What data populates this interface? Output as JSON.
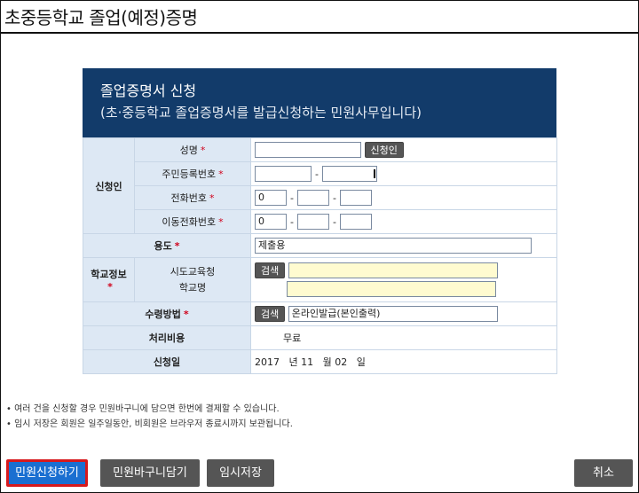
{
  "window": {
    "title": "초중등학교 졸업(예정)증명"
  },
  "form": {
    "header_title": "졸업증명서 신청",
    "header_subtitle": "(초·중등학교 졸업증명서를 발급신청하는 민원사무입니다)",
    "required_mark": "*",
    "applicant_group": "신청인",
    "name_label": "성명",
    "name_check_button": "신청인",
    "rrn_label": "주민등록번호",
    "phone_label": "전화번호",
    "mobile_label": "이동전화번호",
    "phone_prefix": "0",
    "mobile_prefix": "0",
    "dash": "-",
    "purpose_label": "용도",
    "purpose_value": "제출용",
    "school_group": "학교정보",
    "edu_office_label": "시도교육청",
    "school_name_label": "학교명",
    "search_button": "검색",
    "receive_label": "수령방법",
    "receive_value": "온라인발급(본인출력)",
    "fee_label": "처리비용",
    "fee_value": "무료",
    "date_label": "신청일",
    "date_year": "2017",
    "date_year_unit": "년",
    "date_month": "11",
    "date_month_unit": "월",
    "date_day": "02",
    "date_day_unit": "일"
  },
  "notes": [
    "• 여러 건을 신청할 경우 민원바구니에 담으면 한번에 결제할 수 있습니다.",
    "• 임시 저장은 회원은 일주일동안, 비회원은 브라우저 종료시까지 보관됩니다."
  ],
  "buttons": {
    "submit": "민원신청하기",
    "basket": "민원바구니담기",
    "temp_save": "임시저장",
    "cancel": "취소"
  },
  "colors": {
    "header_bg": "#123b6a",
    "label_bg": "#dde8f4",
    "primary_button": "#1a6fd1",
    "highlight_border": "#d7191c",
    "required": "#d0021b"
  }
}
